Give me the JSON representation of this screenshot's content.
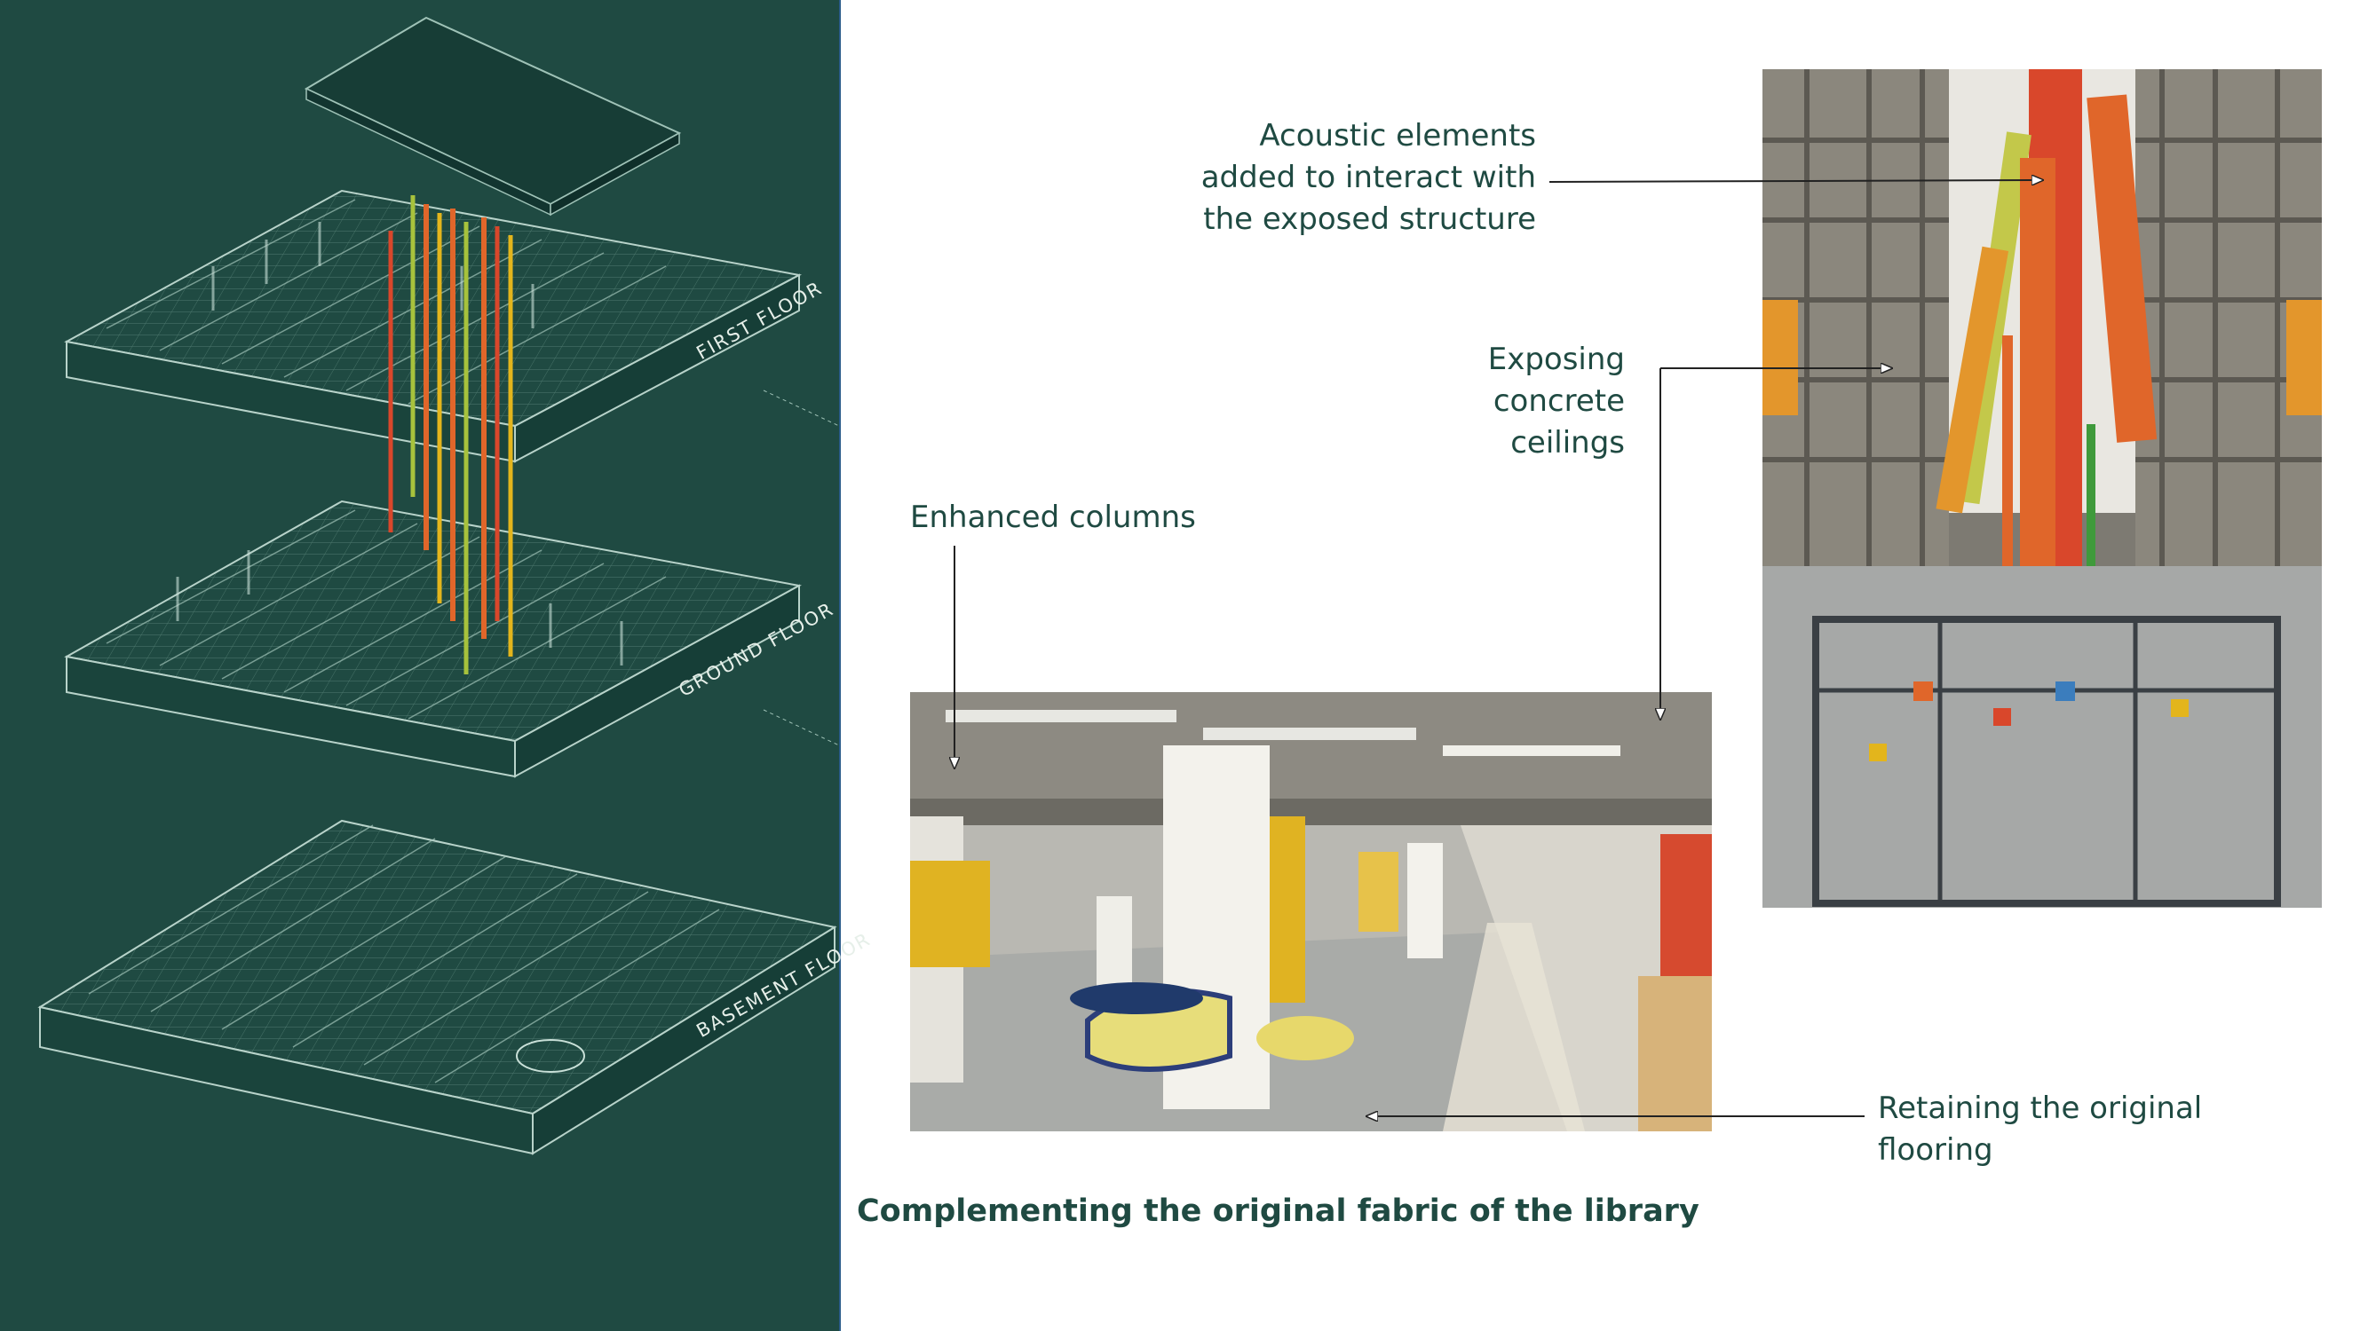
{
  "diagram": {
    "floor_labels": [
      "FIRST FLOOR",
      "GROUND FLOOR",
      "BASEMENT FLOOR"
    ]
  },
  "callouts": {
    "acoustic": [
      "Acoustic elements",
      "added to interact with",
      "the exposed structure"
    ],
    "concrete": [
      "Exposing",
      "concrete",
      "ceilings"
    ],
    "columns": [
      "Enhanced columns"
    ],
    "flooring": [
      "Retaining the original",
      "flooring"
    ]
  },
  "footer": {
    "title": "Complementing the original fabric of the library"
  },
  "colors": {
    "panel_green": "#1f4a42",
    "caption_green": "#1f4a42",
    "accent_orange": "#e0662a",
    "accent_yellow": "#e3b51c",
    "accent_lime": "#a7c23c"
  }
}
